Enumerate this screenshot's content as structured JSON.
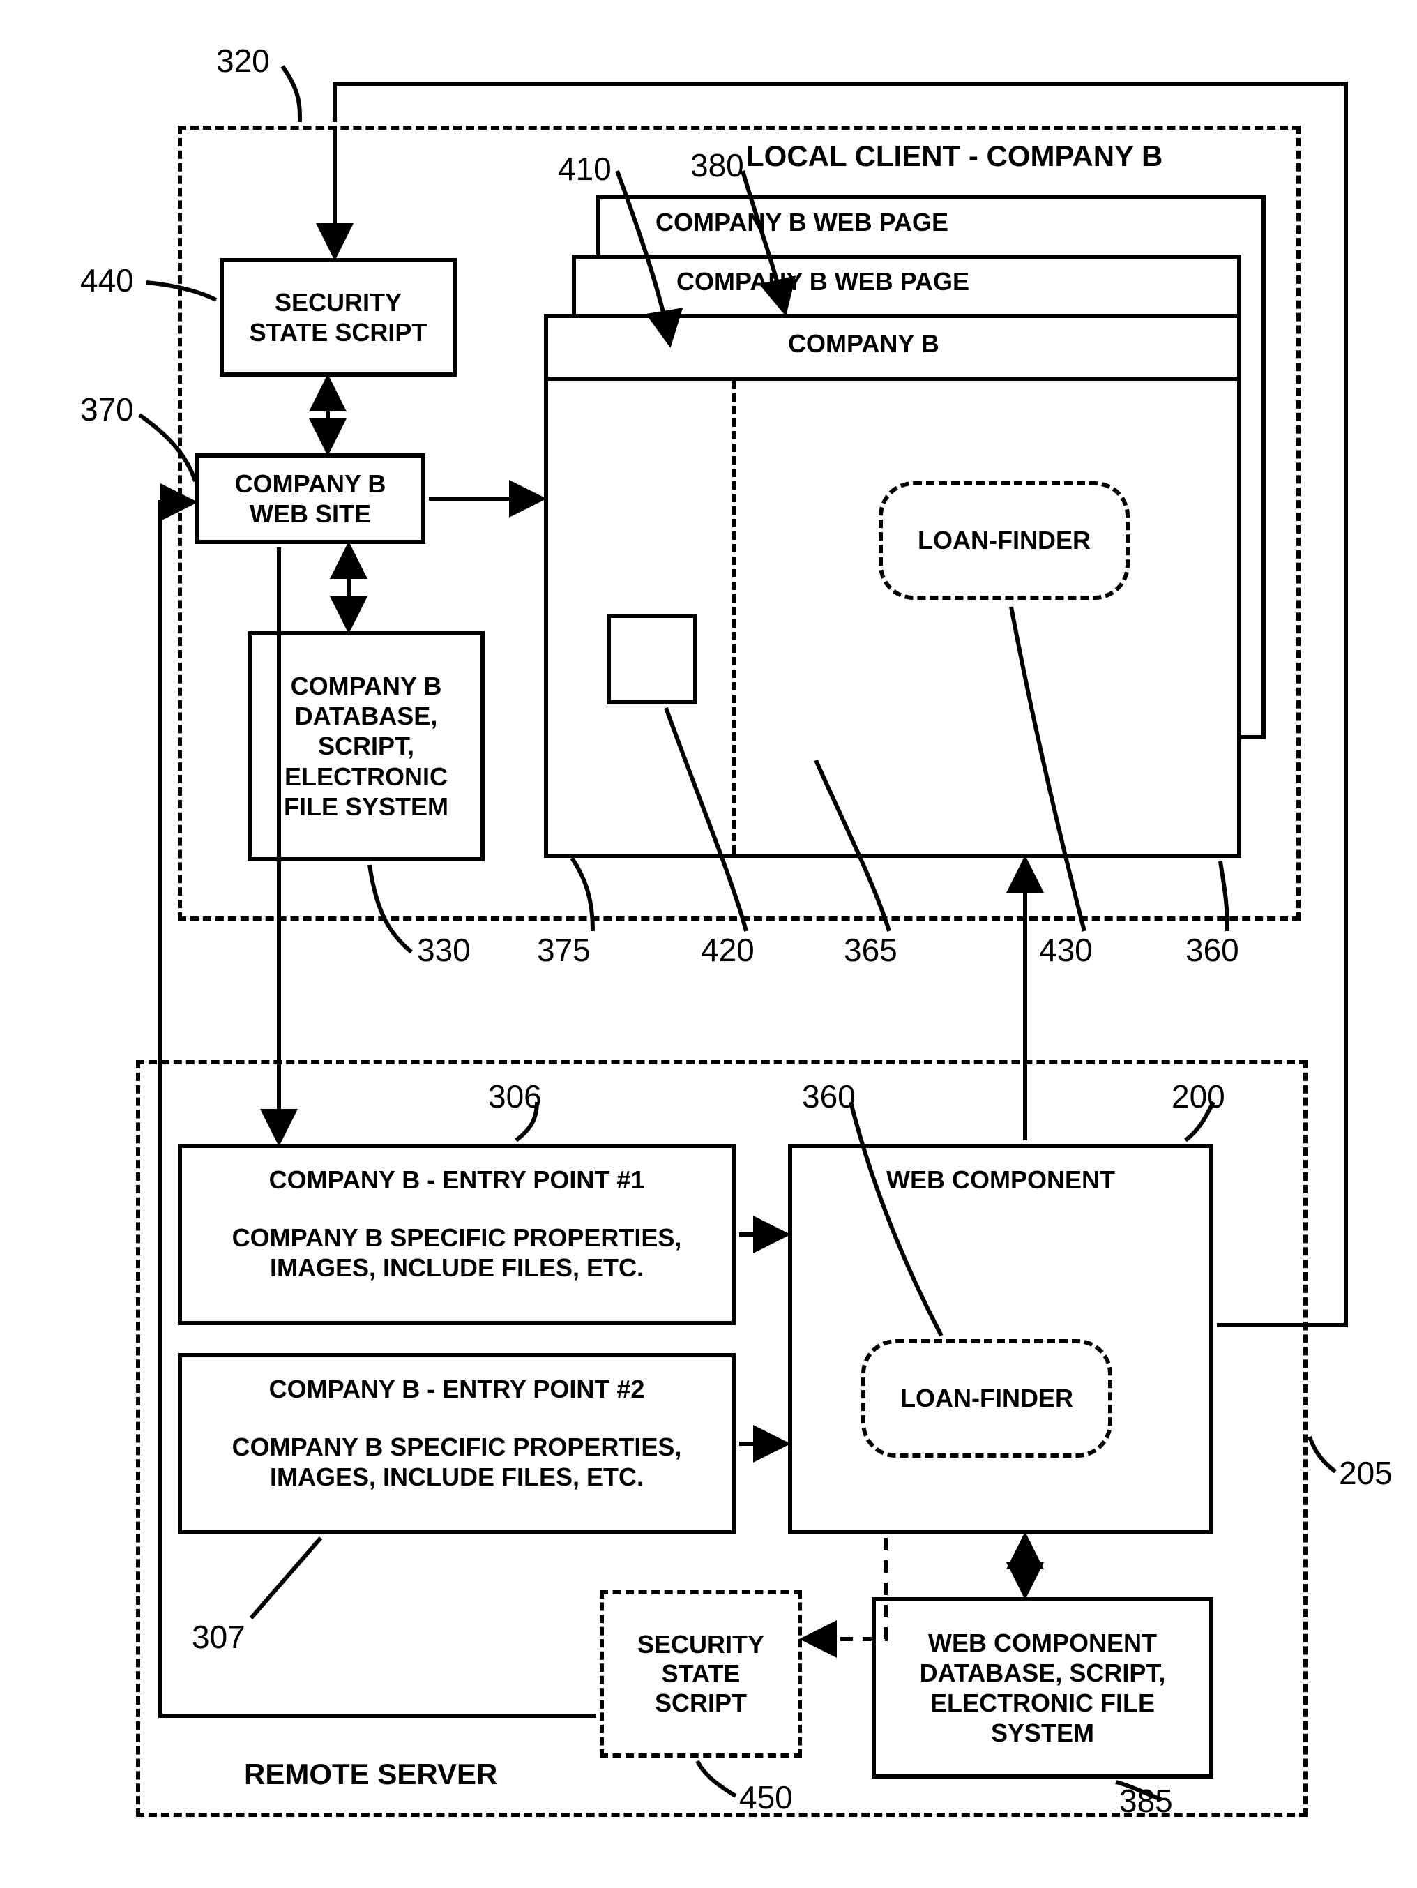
{
  "local_client_title": "LOCAL CLIENT  - COMPANY B",
  "remote_server_title": "REMOTE SERVER",
  "security_state_script": "SECURITY\nSTATE SCRIPT",
  "company_b_web_site": "COMPANY B\nWEB SITE",
  "company_b_database": "COMPANY B\nDATABASE,\nSCRIPT,\nELECTRONIC\nFILE SYSTEM",
  "web_page_back": "COMPANY B WEB PAGE",
  "web_page_mid": "COMPANY B WEB PAGE",
  "web_page_front_title": "COMPANY B",
  "loan_finder": "LOAN-FINDER",
  "entry_point_1_title": "COMPANY B - ENTRY POINT #1",
  "entry_point_1_body": "COMPANY B SPECIFIC PROPERTIES,\nIMAGES, INCLUDE FILES, ETC.",
  "entry_point_2_title": "COMPANY B - ENTRY POINT #2",
  "entry_point_2_body": "COMPANY B SPECIFIC PROPERTIES,\nIMAGES, INCLUDE FILES, ETC.",
  "web_component_title": "WEB COMPONENT",
  "web_component_db": "WEB COMPONENT\nDATABASE, SCRIPT,\nELECTRONIC FILE\nSYSTEM",
  "security_state_script_dashed": "SECURITY\nSTATE\nSCRIPT",
  "refs": {
    "r320": "320",
    "r440": "440",
    "r370": "370",
    "r330": "330",
    "r410": "410",
    "r380": "380",
    "r375": "375",
    "r420": "420",
    "r365": "365",
    "r430": "430",
    "r360a": "360",
    "r306": "306",
    "r307": "307",
    "r360b": "360",
    "r200": "200",
    "r205": "205",
    "r450": "450",
    "r385": "385"
  }
}
